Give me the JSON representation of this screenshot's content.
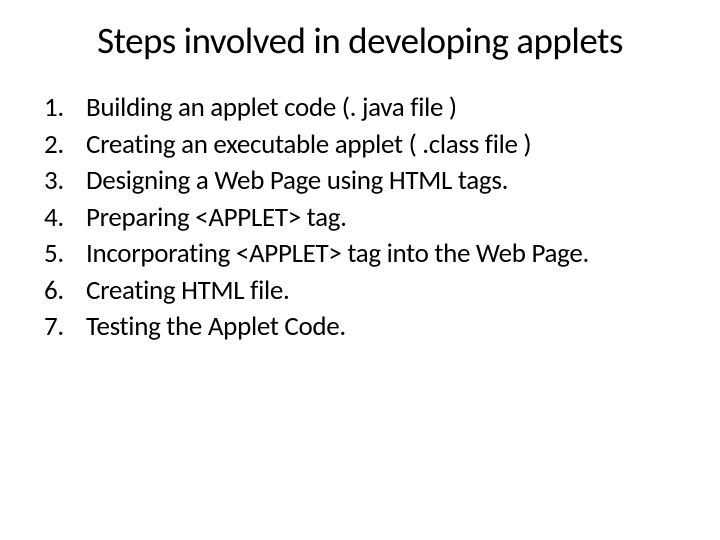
{
  "title": "Steps involved in developing applets",
  "steps": [
    "Building an applet code (. java file )",
    "Creating an executable applet ( .class file )",
    "Designing a Web Page using HTML tags.",
    "Preparing <APPLET> tag.",
    "Incorporating <APPLET> tag into the Web Page.",
    "Creating HTML file.",
    "Testing the Applet Code."
  ]
}
